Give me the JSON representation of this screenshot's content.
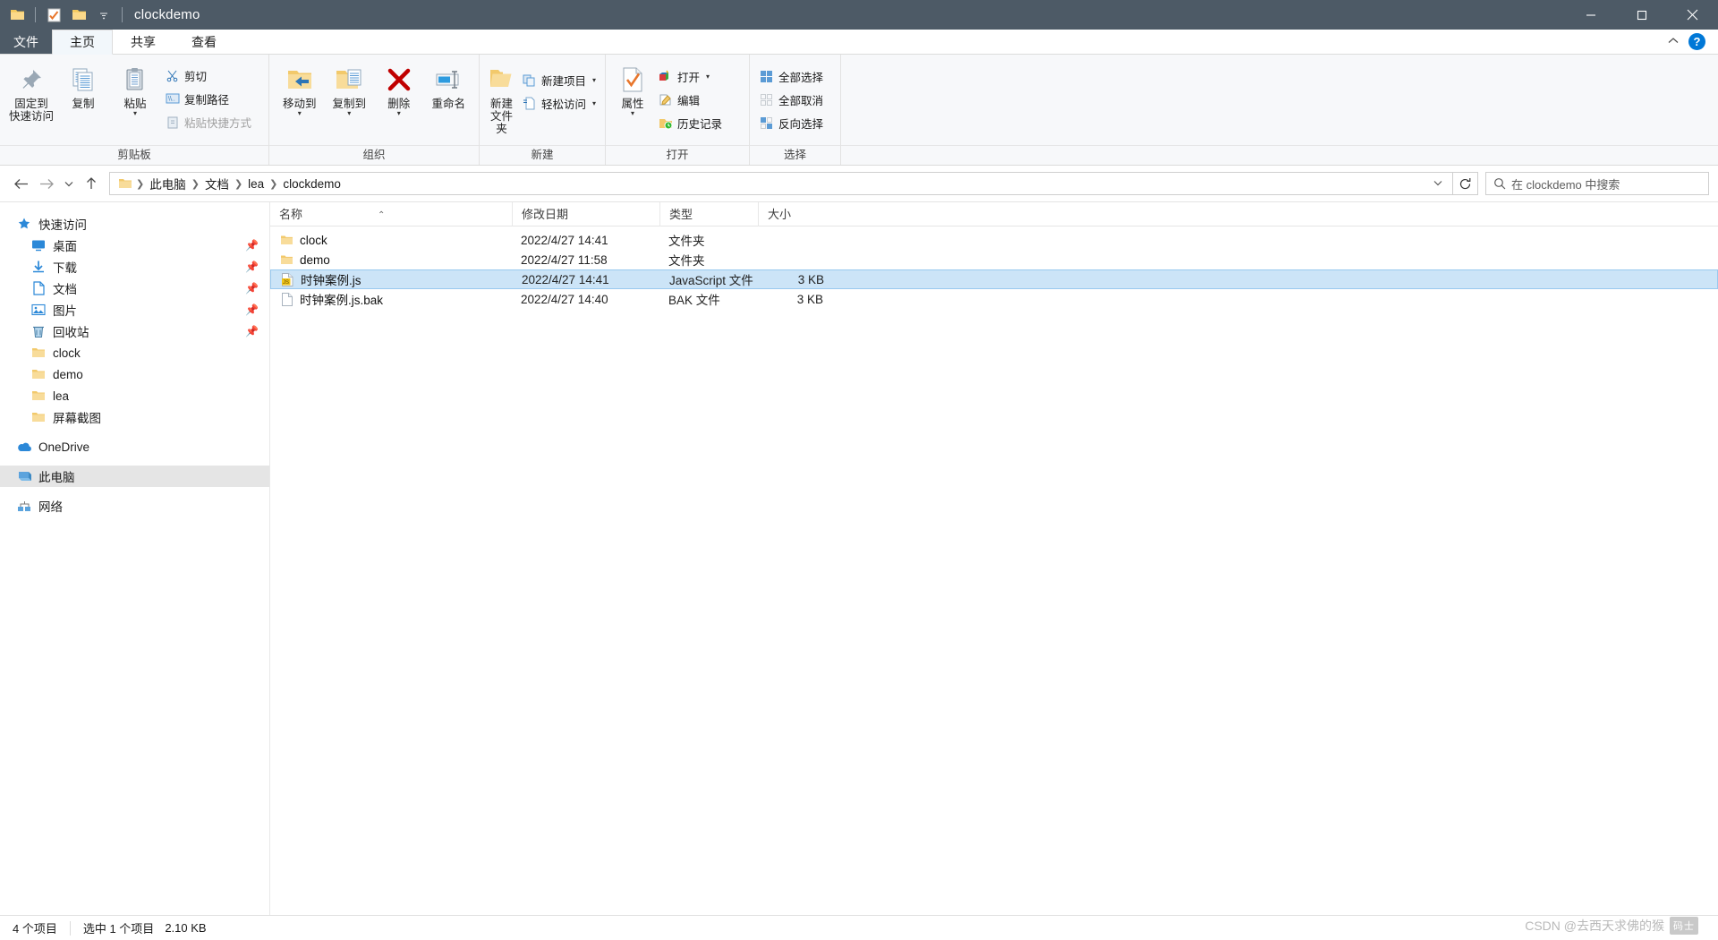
{
  "window": {
    "title": "clockdemo",
    "quick_access_icons": [
      "folder-icon",
      "properties-icon",
      "new-folder-icon",
      "chevron-down-icon"
    ],
    "minimize_label": "最小化",
    "maximize_label": "最大化",
    "close_label": "关闭"
  },
  "tabs": {
    "file_menu": "文件",
    "items": [
      {
        "label": "主页",
        "active": true
      },
      {
        "label": "共享",
        "active": false
      },
      {
        "label": "查看",
        "active": false
      }
    ],
    "collapse_icon": "chevron-up-icon",
    "help_label": "?"
  },
  "ribbon": {
    "groups": [
      {
        "name": "clipboard",
        "label": "剪贴板",
        "big_buttons": [
          {
            "label": "固定到\n快速访问",
            "line1": "固定到",
            "line2": "快速访问",
            "icon": "pin-icon"
          },
          {
            "label": "复制",
            "icon": "copy-icon"
          },
          {
            "label": "粘贴",
            "icon": "paste-icon",
            "caret": true
          }
        ],
        "small_buttons": [
          {
            "label": "剪切",
            "icon": "scissors-icon",
            "dim": false
          },
          {
            "label": "复制路径",
            "icon": "copy-path-icon",
            "dim": false
          },
          {
            "label": "粘贴快捷方式",
            "icon": "paste-shortcut-icon",
            "dim": true
          }
        ]
      },
      {
        "name": "organize",
        "label": "组织",
        "big_buttons": [
          {
            "label": "移动到",
            "icon": "move-to-icon",
            "caret": true
          },
          {
            "label": "复制到",
            "icon": "copy-to-icon",
            "caret": true
          },
          {
            "label": "删除",
            "icon": "delete-icon",
            "caret": true
          },
          {
            "label": "重命名",
            "icon": "rename-icon"
          }
        ],
        "small_buttons": []
      },
      {
        "name": "new",
        "label": "新建",
        "big_buttons": [
          {
            "line1": "新建",
            "line2": "文件夹",
            "label": "新建文件夹",
            "icon": "new-folder-icon"
          }
        ],
        "small_buttons": [
          {
            "label": "新建项目",
            "icon": "new-item-icon",
            "dropdown": true
          },
          {
            "label": "轻松访问",
            "icon": "easy-access-icon",
            "dropdown": true
          }
        ]
      },
      {
        "name": "open",
        "label": "打开",
        "big_buttons": [
          {
            "label": "属性",
            "icon": "properties-icon",
            "caret": true
          }
        ],
        "small_buttons": [
          {
            "label": "打开",
            "icon": "open-with-icon",
            "dropdown": true
          },
          {
            "label": "编辑",
            "icon": "edit-icon"
          },
          {
            "label": "历史记录",
            "icon": "history-icon"
          }
        ]
      },
      {
        "name": "select",
        "label": "选择",
        "big_buttons": [],
        "small_buttons": [
          {
            "label": "全部选择",
            "icon": "select-all-icon"
          },
          {
            "label": "全部取消",
            "icon": "select-none-icon"
          },
          {
            "label": "反向选择",
            "icon": "invert-selection-icon"
          }
        ]
      }
    ]
  },
  "address": {
    "back_icon": "arrow-left-icon",
    "forward_icon": "arrow-right-icon",
    "recent_icon": "chevron-down-icon",
    "up_icon": "arrow-up-icon",
    "folder_icon": "folder-icon",
    "breadcrumbs": [
      "此电脑",
      "文档",
      "lea",
      "clockdemo"
    ],
    "dropdown_icon": "chevron-down-icon",
    "refresh_icon": "refresh-icon",
    "search_placeholder": "在 clockdemo 中搜索",
    "search_value": "",
    "search_icon": "search-icon"
  },
  "sidebar": {
    "items": [
      {
        "label": "快速访问",
        "icon": "star-icon",
        "level": 0,
        "pin": false,
        "selected": false
      },
      {
        "label": "桌面",
        "icon": "desktop-icon",
        "level": 1,
        "pin": true,
        "selected": false
      },
      {
        "label": "下载",
        "icon": "download-icon",
        "level": 1,
        "pin": true,
        "selected": false
      },
      {
        "label": "文档",
        "icon": "documents-icon",
        "level": 1,
        "pin": true,
        "selected": false
      },
      {
        "label": "图片",
        "icon": "pictures-icon",
        "level": 1,
        "pin": true,
        "selected": false
      },
      {
        "label": "回收站",
        "icon": "recycle-bin-icon",
        "level": 1,
        "pin": true,
        "selected": false
      },
      {
        "label": "clock",
        "icon": "folder-icon",
        "level": 1,
        "pin": false,
        "selected": false
      },
      {
        "label": "demo",
        "icon": "folder-icon",
        "level": 1,
        "pin": false,
        "selected": false
      },
      {
        "label": "lea",
        "icon": "folder-icon",
        "level": 1,
        "pin": false,
        "selected": false
      },
      {
        "label": "屏幕截图",
        "icon": "folder-icon",
        "level": 1,
        "pin": false,
        "selected": false
      },
      {
        "label": "OneDrive",
        "icon": "onedrive-icon",
        "level": 0,
        "pin": false,
        "selected": false,
        "gap_before": true
      },
      {
        "label": "此电脑",
        "icon": "this-pc-icon",
        "level": 0,
        "pin": false,
        "selected": true,
        "gap_before": true
      },
      {
        "label": "网络",
        "icon": "network-icon",
        "level": 0,
        "pin": false,
        "selected": false,
        "gap_before": true
      }
    ]
  },
  "filelist": {
    "columns": [
      {
        "label": "名称",
        "key": "name",
        "sorted": true,
        "sort_dir": "asc"
      },
      {
        "label": "修改日期",
        "key": "date"
      },
      {
        "label": "类型",
        "key": "type"
      },
      {
        "label": "大小",
        "key": "size"
      }
    ],
    "rows": [
      {
        "name": "clock",
        "date": "2022/4/27 14:41",
        "type": "文件夹",
        "size": "",
        "icon": "folder-icon",
        "selected": false
      },
      {
        "name": "demo",
        "date": "2022/4/27 11:58",
        "type": "文件夹",
        "size": "",
        "icon": "folder-icon",
        "selected": false
      },
      {
        "name": "时钟案例.js",
        "date": "2022/4/27 14:41",
        "type": "JavaScript 文件",
        "size": "3 KB",
        "icon": "js-file-icon",
        "selected": true
      },
      {
        "name": "时钟案例.js.bak",
        "date": "2022/4/27 14:40",
        "type": "BAK 文件",
        "size": "3 KB",
        "icon": "generic-file-icon",
        "selected": false
      }
    ]
  },
  "statusbar": {
    "item_count": "4 个项目",
    "selection": "选中 1 个项目",
    "selection_size": "2.10 KB"
  },
  "watermark": {
    "text": "CSDN @去西天求佛的猴",
    "badge": "码士"
  },
  "colors": {
    "titlebar": "#4d5a66",
    "accent": "#0078d7",
    "selection": "#cce4f7",
    "folder": "#f7d185",
    "ribbon_bg": "#f7f8fa"
  }
}
